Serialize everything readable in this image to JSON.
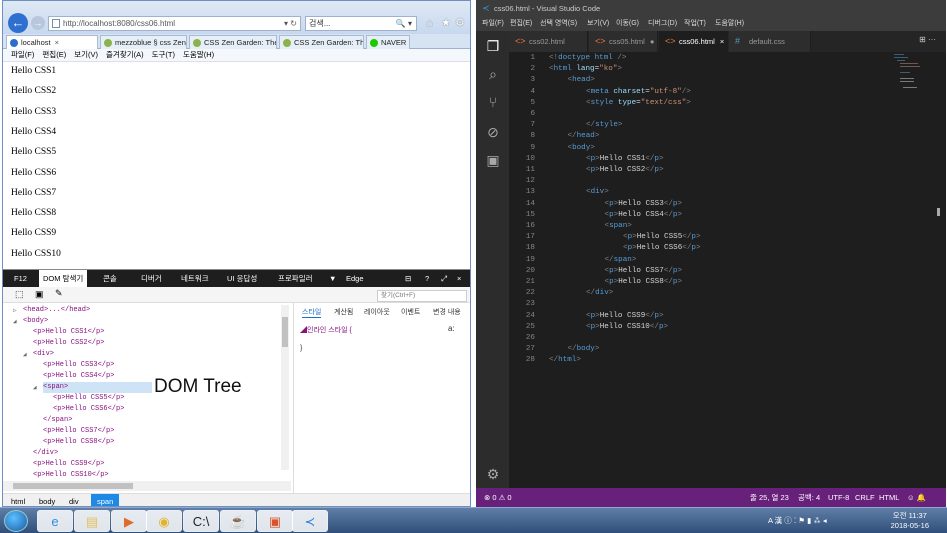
{
  "ie": {
    "url": "http://localhost:8080/css06.html",
    "url_buttons": "▾ ↻",
    "search_placeholder": "검색...",
    "search_icon": "🔍 ▾",
    "tabs": [
      {
        "label": "localhost",
        "color": "#2a6fd0",
        "close": "×"
      },
      {
        "label": "mezzoblue § css Zen...",
        "color": "#8bb34a",
        "close": ""
      },
      {
        "label": "CSS Zen Garden: The...",
        "color": "#8bb34a",
        "close": ""
      },
      {
        "label": "CSS Zen Garden: The...",
        "color": "#8bb34a",
        "close": ""
      },
      {
        "label": "NAVER",
        "color": "#1ec800",
        "close": ""
      }
    ],
    "menu": [
      "파일(F)",
      "편집(E)",
      "보기(V)",
      "즐겨찾기(A)",
      "도구(T)",
      "도움말(H)"
    ],
    "page_lines": [
      "Hello CSS1",
      "Hello CSS2",
      "Hello CSS3",
      "Hello CSS4",
      "Hello CSS5",
      "Hello CSS6",
      "Hello CSS7",
      "Hello CSS8",
      "Hello CSS9",
      "Hello CSS10"
    ]
  },
  "devtools": {
    "tabs": [
      "F12",
      "DOM 탐색기",
      "콘솔",
      "디버거",
      "네트워크",
      "UI 응답성",
      "프로파일러",
      "▼",
      "Edge"
    ],
    "active_tab": "DOM 탐색기",
    "find_placeholder": "찾기(Ctrl+F)",
    "dom_rows": [
      {
        "indent": 0,
        "arrow": "▷",
        "text": "<head>...</head>"
      },
      {
        "indent": 0,
        "arrow": "◢",
        "text": "<body>"
      },
      {
        "indent": 1,
        "arrow": "",
        "text": "<p>Hello CSS1</p>"
      },
      {
        "indent": 1,
        "arrow": "",
        "text": "<p>Hello CSS2</p>"
      },
      {
        "indent": 1,
        "arrow": "◢",
        "text": "<div>"
      },
      {
        "indent": 2,
        "arrow": "",
        "text": "<p>Hello CSS3</p>"
      },
      {
        "indent": 2,
        "arrow": "",
        "text": "<p>Hello CSS4</p>"
      },
      {
        "indent": 2,
        "arrow": "◢",
        "text": "<span>"
      },
      {
        "indent": 3,
        "arrow": "",
        "text": "<p>Hello CSS5</p>"
      },
      {
        "indent": 3,
        "arrow": "",
        "text": "<p>Hello CSS6</p>"
      },
      {
        "indent": 2,
        "arrow": "",
        "text": "</span>"
      },
      {
        "indent": 2,
        "arrow": "",
        "text": "<p>Hello CSS7</p>"
      },
      {
        "indent": 2,
        "arrow": "",
        "text": "<p>Hello CSS8</p>"
      },
      {
        "indent": 1,
        "arrow": "",
        "text": "</div>"
      },
      {
        "indent": 1,
        "arrow": "",
        "text": "<p>Hello CSS9</p>"
      },
      {
        "indent": 1,
        "arrow": "",
        "text": "<p>Hello CSS10</p>"
      }
    ],
    "selected_row": 7,
    "style_tabs": [
      "스타일",
      "계산됨",
      "레이아웃",
      "이벤트",
      "변경 내용"
    ],
    "inline_style": "◢인라인 스타일  {",
    "inline_close": "}",
    "aa": "a:",
    "breadcrumb": [
      "html",
      "body",
      "div",
      "span"
    ],
    "annotation": "DOM Tree"
  },
  "vscode": {
    "title": "css06.html - Visual Studio Code",
    "menu": [
      "파일(F)",
      "편집(E)",
      "선택 영역(S)",
      "보기(V)",
      "이동(G)",
      "디버그(D)",
      "작업(T)",
      "도움말(H)"
    ],
    "tabs": [
      {
        "label": "css02.html",
        "icon": "<>"
      },
      {
        "label": "css05.html",
        "icon": "<>",
        "dot": "●"
      },
      {
        "label": "css06.html",
        "icon": "<>",
        "close": "×"
      },
      {
        "label": "default.css",
        "icon": "#"
      }
    ],
    "tab_actions": "⊞  ···",
    "code": [
      {
        "i": 0,
        "h": "<span class='gr'>&lt;!</span><span class='tg'>doctype html</span><span class='gr'> /&gt;</span>"
      },
      {
        "i": 0,
        "h": "<span class='gr'>&lt;</span><span class='tg'>html</span> <span class='at'>lang</span>=<span class='st'>\"ko\"</span><span class='gr'>&gt;</span>"
      },
      {
        "i": 1,
        "h": "<span class='gr'>&lt;</span><span class='tg'>head</span><span class='gr'>&gt;</span>"
      },
      {
        "i": 2,
        "h": "<span class='gr'>&lt;</span><span class='tg'>meta</span> <span class='at'>charset</span>=<span class='st'>\"utf-8\"</span><span class='gr'>/&gt;</span>"
      },
      {
        "i": 2,
        "h": "<span class='gr'>&lt;</span><span class='tg'>style</span> <span class='at'>type</span>=<span class='st'>\"text/css\"</span><span class='gr'>&gt;</span>"
      },
      {
        "i": 2,
        "h": ""
      },
      {
        "i": 2,
        "h": "<span class='gr'>&lt;/</span><span class='tg'>style</span><span class='gr'>&gt;</span>"
      },
      {
        "i": 1,
        "h": "<span class='gr'>&lt;/</span><span class='tg'>head</span><span class='gr'>&gt;</span>"
      },
      {
        "i": 1,
        "h": "<span class='gr'>&lt;</span><span class='tg'>body</span><span class='gr'>&gt;</span>"
      },
      {
        "i": 2,
        "h": "<span class='gr'>&lt;</span><span class='tg'>p</span><span class='gr'>&gt;</span>Hello CSS1<span class='gr'>&lt;/</span><span class='tg'>p</span><span class='gr'>&gt;</span>"
      },
      {
        "i": 2,
        "h": "<span class='gr'>&lt;</span><span class='tg'>p</span><span class='gr'>&gt;</span>Hello CSS2<span class='gr'>&lt;/</span><span class='tg'>p</span><span class='gr'>&gt;</span>"
      },
      {
        "i": 2,
        "h": ""
      },
      {
        "i": 2,
        "h": "<span class='gr'>&lt;</span><span class='tg'>div</span><span class='gr'>&gt;</span>"
      },
      {
        "i": 3,
        "h": "<span class='gr'>&lt;</span><span class='tg'>p</span><span class='gr'>&gt;</span>Hello CSS3<span class='gr'>&lt;/</span><span class='tg'>p</span><span class='gr'>&gt;</span>"
      },
      {
        "i": 3,
        "h": "<span class='gr'>&lt;</span><span class='tg'>p</span><span class='gr'>&gt;</span>Hello CSS4<span class='gr'>&lt;/</span><span class='tg'>p</span><span class='gr'>&gt;</span>"
      },
      {
        "i": 3,
        "h": "<span class='gr'>&lt;</span><span class='tg'>span</span><span class='gr'>&gt;</span>"
      },
      {
        "i": 4,
        "h": "<span class='gr'>&lt;</span><span class='tg'>p</span><span class='gr'>&gt;</span>Hello CSS5<span class='gr'>&lt;/</span><span class='tg'>p</span><span class='gr'>&gt;</span>"
      },
      {
        "i": 4,
        "h": "<span class='gr'>&lt;</span><span class='tg'>p</span><span class='gr'>&gt;</span>Hello CSS6<span class='gr'>&lt;/</span><span class='tg'>p</span><span class='gr'>&gt;</span>"
      },
      {
        "i": 3,
        "h": "<span class='gr'>&lt;/</span><span class='tg'>span</span><span class='gr'>&gt;</span>"
      },
      {
        "i": 3,
        "h": "<span class='gr'>&lt;</span><span class='tg'>p</span><span class='gr'>&gt;</span>Hello CSS7<span class='gr'>&lt;/</span><span class='tg'>p</span><span class='gr'>&gt;</span>"
      },
      {
        "i": 3,
        "h": "<span class='gr'>&lt;</span><span class='tg'>p</span><span class='gr'>&gt;</span>Hello CSS8<span class='gr'>&lt;/</span><span class='tg'>p</span><span class='gr'>&gt;</span>"
      },
      {
        "i": 2,
        "h": "<span class='gr'>&lt;/</span><span class='tg'>div</span><span class='gr'>&gt;</span>"
      },
      {
        "i": 2,
        "h": ""
      },
      {
        "i": 2,
        "h": "<span class='gr'>&lt;</span><span class='tg'>p</span><span class='gr'>&gt;</span>Hello CSS9<span class='gr'>&lt;/</span><span class='tg'>p</span><span class='gr'>&gt;</span>"
      },
      {
        "i": 2,
        "h": "<span class='gr'>&lt;</span><span class='tg'>p</span><span class='gr'>&gt;</span>Hello CSS10<span class='gr'>&lt;/</span><span class='tg'>p</span><span class='gr'>&gt;</span>"
      },
      {
        "i": 2,
        "h": ""
      },
      {
        "i": 1,
        "h": "<span class='gr'>&lt;/</span><span class='tg'>body</span><span class='gr'>&gt;</span>"
      },
      {
        "i": 0,
        "h": "<span class='gr'>&lt;/</span><span class='tg'>html</span><span class='gr'>&gt;</span>"
      }
    ],
    "status_left": "⊗ 0  ⚠ 0",
    "status_pos": "줄 25, 열 23",
    "status_spaces": "공백: 4",
    "status_enc": "UTF-8",
    "status_eol": "CRLF",
    "status_lang": "HTML",
    "status_icons": "☺  🔔",
    "status_color": "#68217a"
  },
  "taskbar": {
    "items": [
      {
        "name": "ie-taskbar-icon",
        "glyph": "e",
        "color": "#2f8fe0"
      },
      {
        "name": "explorer-taskbar-icon",
        "glyph": "▤",
        "color": "#e8c15a"
      },
      {
        "name": "media-player-taskbar-icon",
        "glyph": "▶",
        "color": "#e06a2a"
      },
      {
        "name": "chrome-taskbar-icon",
        "glyph": "◉",
        "color": "#e5b32a"
      },
      {
        "name": "cmd-taskbar-icon",
        "glyph": "C:\\",
        "color": "#222"
      },
      {
        "name": "java-taskbar-icon",
        "glyph": "☕",
        "color": "#e07a2a"
      },
      {
        "name": "presentation-taskbar-icon",
        "glyph": "▣",
        "color": "#d9532a"
      },
      {
        "name": "vscode-taskbar-icon",
        "glyph": "≺",
        "color": "#2f7fd6"
      }
    ],
    "tray_text": "A 漢 ⓘ ⁚ ⚑ ▮ ⁂ ◂",
    "time": "오전 11:37",
    "date": "2018-05-16"
  }
}
